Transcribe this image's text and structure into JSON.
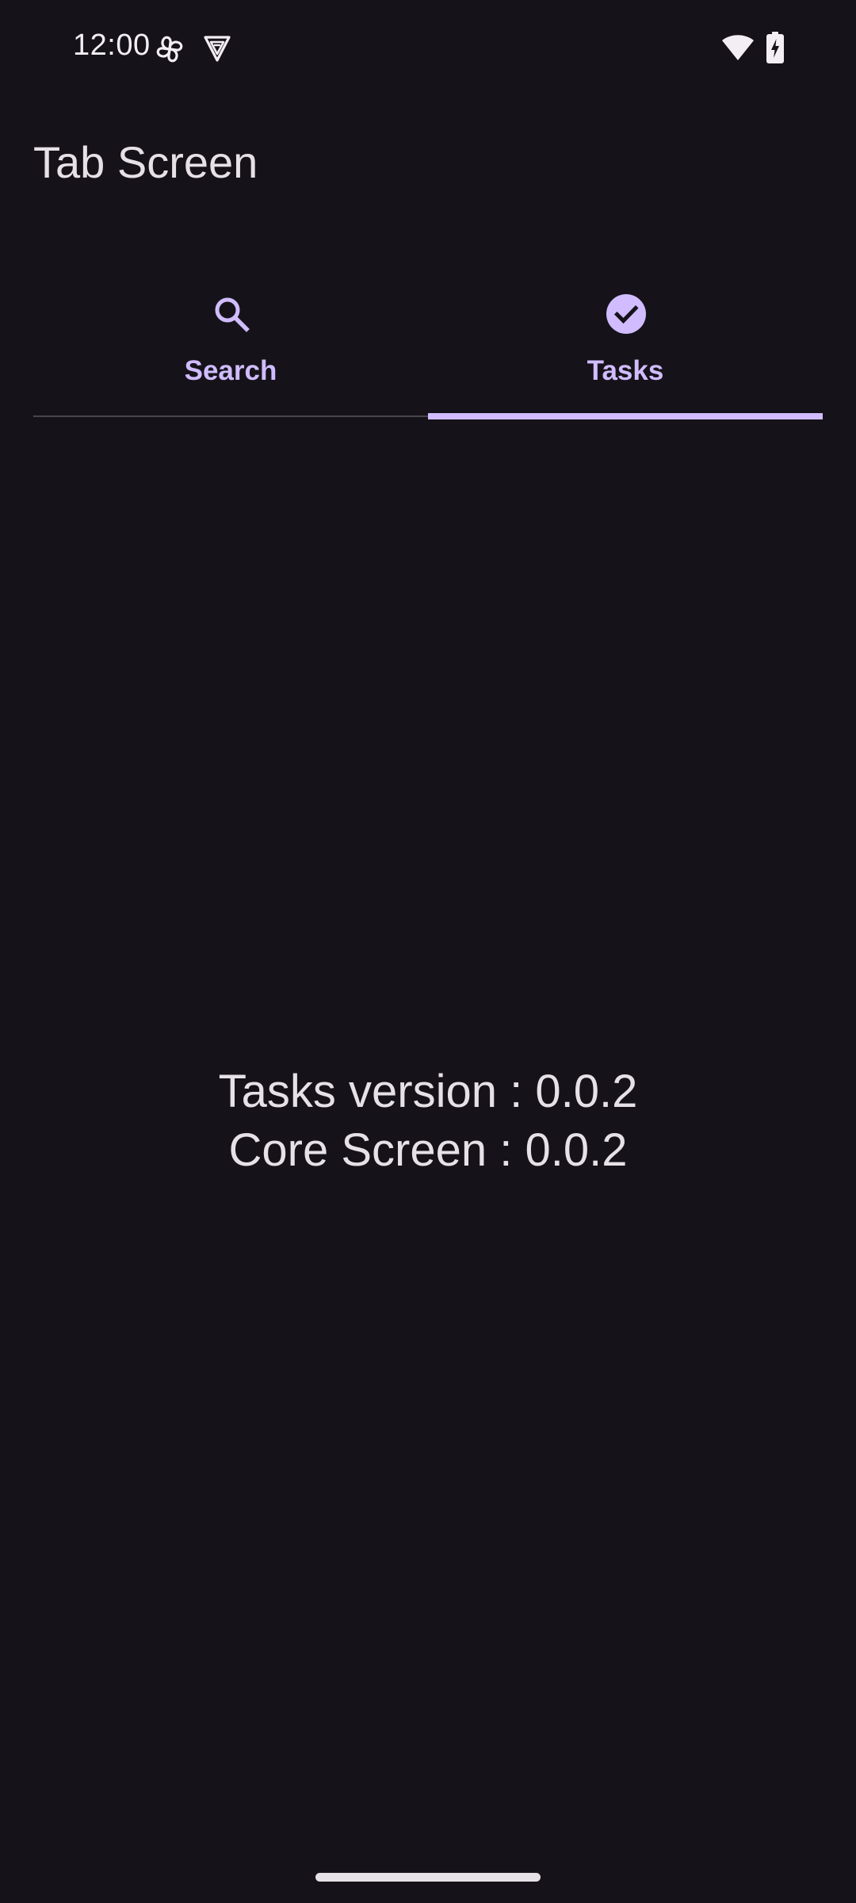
{
  "status_bar": {
    "time": "12:00",
    "left_icons": [
      "fan-icon",
      "vpn-icon"
    ],
    "right_icons": [
      "wifi-icon",
      "battery-charging-icon"
    ]
  },
  "app_bar": {
    "title": "Tab Screen"
  },
  "tabs": [
    {
      "label": "Search",
      "icon": "search-icon",
      "selected": false
    },
    {
      "label": "Tasks",
      "icon": "check-circle-icon",
      "selected": true
    }
  ],
  "content": {
    "tasks_version": "Tasks version : 0.0.2",
    "core_screen": "Core Screen : 0.0.2"
  },
  "colors": {
    "background": "#151319",
    "accent": "#d0bcff",
    "on_surface": "#e6e1e6",
    "divider": "#49454f"
  }
}
